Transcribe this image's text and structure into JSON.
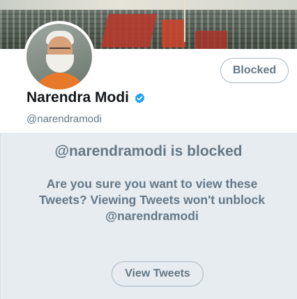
{
  "profile": {
    "name": "Narendra Modi",
    "handle": "@narendramodi",
    "verified": true,
    "blocked_button_label": "Blocked"
  },
  "blocked_notice": {
    "title": "@narendramodi is blocked",
    "body": "Are you sure you want to view these Tweets? Viewing Tweets won't unblock @narendramodi",
    "view_button_label": "View Tweets"
  },
  "icons": {
    "verified": "verified-badge-icon"
  },
  "colors": {
    "verified_blue": "#1da1f2",
    "muted_text": "#657786",
    "notice_background": "#e6ecf0",
    "name_text": "#14171a"
  }
}
